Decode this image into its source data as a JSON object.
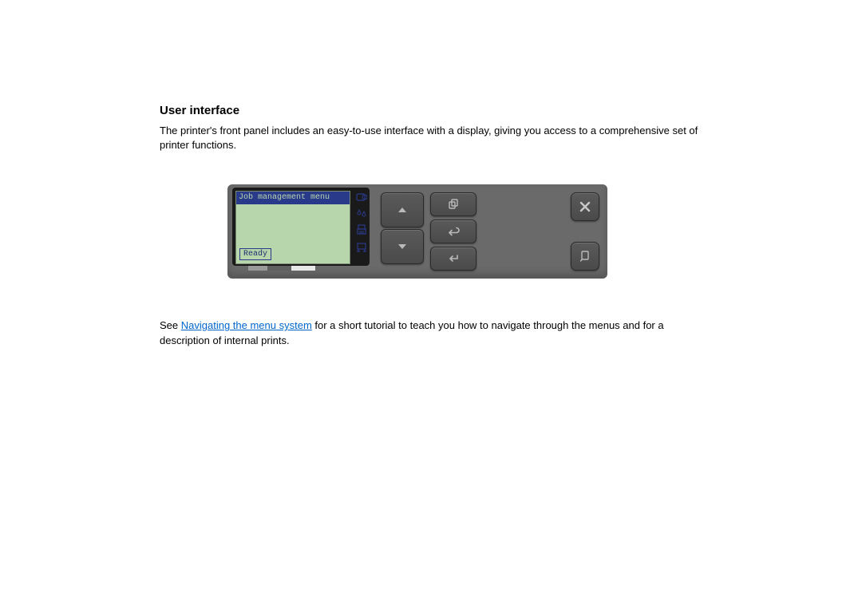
{
  "doc": {
    "heading": "User interface",
    "intro": "The printer's front panel includes an easy-to-use interface with a display, giving you access to a comprehensive set of printer functions.",
    "footer_pre": "See ",
    "footer_link": "Navigating the menu system",
    "footer_post": " for a short tutorial to teach you how to navigate through the menus and for a description of internal prints."
  },
  "panel": {
    "display": {
      "title": "Job management menu",
      "status": "Ready"
    },
    "icons": {
      "paper": "paper-roll",
      "ink": "ink-drops",
      "printhead": "printhead",
      "printer": "printer"
    },
    "buttons": {
      "up": "Up",
      "down": "Down",
      "copy": "Copy",
      "back": "Back",
      "enter": "Enter",
      "cancel": "Cancel",
      "form_feed": "Form feed"
    }
  }
}
